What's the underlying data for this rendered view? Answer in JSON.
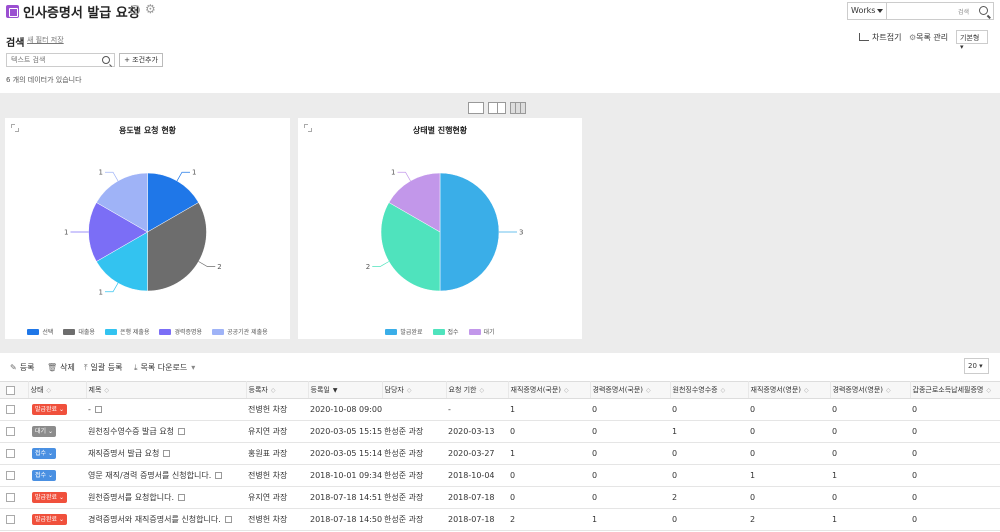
{
  "header": {
    "title": "인사증명서 발급 요청",
    "works_select": "Works",
    "search_scope": "검색"
  },
  "filter": {
    "search_label": "검색",
    "save_filter": "새 필터 저장",
    "text_search_placeholder": "텍스트 검색",
    "add_condition": "+ 조건추가",
    "count_text": "6 개의 데이터가 있습니다",
    "chart_fold": "차트접기",
    "list_manage": "목록 관리",
    "view_select": "기본형"
  },
  "chart_data": [
    {
      "type": "pie",
      "title": "용도별 요청 현황",
      "categories": [
        "선택",
        "대출용",
        "은행 제출용",
        "경력증명용",
        "공공기관 제출용"
      ],
      "values": [
        1,
        2,
        1,
        1,
        1
      ],
      "colors": [
        "#1f77e8",
        "#6d6d6d",
        "#33c3f0",
        "#7b6ef6",
        "#9fb3f7"
      ],
      "legend": "bottom"
    },
    {
      "type": "pie",
      "title": "상태별 진행현황",
      "categories": [
        "발급완료",
        "접수",
        "대기"
      ],
      "values": [
        3,
        2,
        1
      ],
      "colors": [
        "#3aaee8",
        "#4fe3bd",
        "#c297ea"
      ],
      "legend": "bottom"
    }
  ],
  "toolbar": {
    "register": "등록",
    "delete": "삭제",
    "bulk_register": "일괄 등록",
    "list_download": "목록 다운로드",
    "page_size": "20"
  },
  "table": {
    "columns": [
      "상태",
      "제목",
      "등록자",
      "등록일",
      "담당자",
      "요청 기한",
      "재직증명서(국문)",
      "경력증명서(국문)",
      "원천징수영수증",
      "재직증명서(영문)",
      "경력증명서(영문)",
      "갑종근로소득납세필증명"
    ],
    "rows": [
      {
        "status": "발급완료",
        "status_color": "#f0503c",
        "title": "-",
        "author": "전병헌 차장",
        "date": "2020-10-08 09:00",
        "manager": "",
        "due": "-",
        "c1": "1",
        "c2": "0",
        "c3": "0",
        "c4": "0",
        "c5": "0",
        "c6": "0"
      },
      {
        "status": "대기",
        "status_color": "#8c8c8c",
        "title": "원천징수영수증 발급 요청",
        "author": "유지연 과장",
        "date": "2020-03-05 15:15",
        "manager": "한성준 과장",
        "due": "2020-03-13",
        "c1": "0",
        "c2": "0",
        "c3": "1",
        "c4": "0",
        "c5": "0",
        "c6": "0"
      },
      {
        "status": "접수",
        "status_color": "#4a90e2",
        "title": "재직증명서 발급 요청",
        "author": "홍원표 과장",
        "date": "2020-03-05 15:14",
        "manager": "한성준 과장",
        "due": "2020-03-27",
        "c1": "1",
        "c2": "0",
        "c3": "0",
        "c4": "0",
        "c5": "0",
        "c6": "0"
      },
      {
        "status": "접수",
        "status_color": "#4a90e2",
        "title": "영문 재직/경력 증명서를 신청합니다.",
        "author": "전병헌 차장",
        "date": "2018-10-01 09:34",
        "manager": "한성준 과장",
        "due": "2018-10-04",
        "c1": "0",
        "c2": "0",
        "c3": "0",
        "c4": "1",
        "c5": "1",
        "c6": "0"
      },
      {
        "status": "발급완료",
        "status_color": "#f0503c",
        "title": "원천증명서를 요청합니다.",
        "author": "유지연 과장",
        "date": "2018-07-18 14:51",
        "manager": "한성준 과장",
        "due": "2018-07-18",
        "c1": "0",
        "c2": "0",
        "c3": "2",
        "c4": "0",
        "c5": "0",
        "c6": "0"
      },
      {
        "status": "발급완료",
        "status_color": "#f0503c",
        "title": "경력증명서와 재직증명서를 신청합니다.",
        "author": "전병헌 차장",
        "date": "2018-07-18 14:50",
        "manager": "한성준 과장",
        "due": "2018-07-18",
        "c1": "2",
        "c2": "1",
        "c3": "0",
        "c4": "2",
        "c5": "1",
        "c6": "0"
      }
    ]
  }
}
